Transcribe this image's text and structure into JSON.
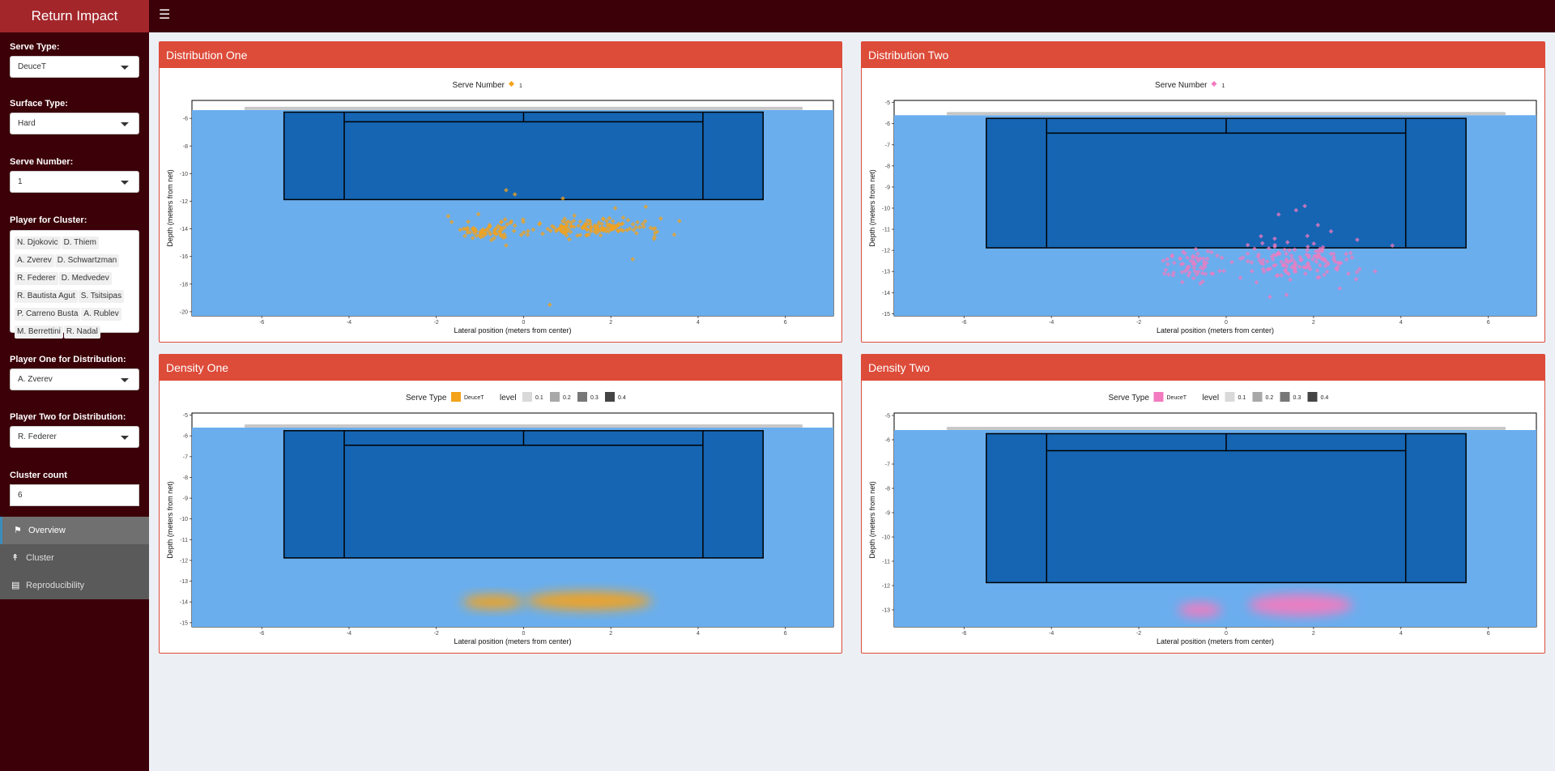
{
  "app": {
    "title": "Return Impact"
  },
  "sidebar": {
    "serve_type": {
      "label": "Serve Type:",
      "value": "DeuceT"
    },
    "surface_type": {
      "label": "Surface Type:",
      "value": "Hard"
    },
    "serve_number": {
      "label": "Serve Number:",
      "value": "1"
    },
    "player_cluster": {
      "label": "Player for Cluster:",
      "tags": [
        "N. Djokovic",
        "D. Thiem",
        "A. Zverev",
        "D. Schwartzman",
        "R. Federer",
        "D. Medvedev",
        "R. Bautista Agut",
        "S. Tsitsipas",
        "P. Carreno Busta",
        "A. Rublev",
        "M. Berrettini",
        "R. Nadal"
      ]
    },
    "player_one": {
      "label": "Player One for Distribution:",
      "value": "A. Zverev"
    },
    "player_two": {
      "label": "Player Two for Distribution:",
      "value": "R. Federer"
    },
    "cluster_count": {
      "label": "Cluster count",
      "value": "6"
    },
    "menu": [
      {
        "label": "Overview",
        "icon": "map-icon"
      },
      {
        "label": "Cluster",
        "icon": "line-chart-icon"
      },
      {
        "label": "Reproducibility",
        "icon": "book-icon"
      }
    ]
  },
  "boxes": {
    "dist_one": {
      "title": "Distribution One"
    },
    "dist_two": {
      "title": "Distribution Two"
    },
    "dens_one": {
      "title": "Density One"
    },
    "dens_two": {
      "title": "Density Two"
    }
  },
  "colors": {
    "accent": "#dd4b39",
    "sidebar": "#3b0008",
    "court_outer": "#6aaeee",
    "court_inner": "#1565b3",
    "orange": "#f4a21a",
    "pink": "#f27bc0"
  },
  "chart_data": [
    {
      "id": "dist_one",
      "type": "scatter",
      "xlabel": "Lateral position (meters from center)",
      "ylabel": "Depth (meters from net)",
      "xticks": [
        -6,
        -4,
        -2,
        0,
        2,
        4,
        6
      ],
      "yticks": [
        -6,
        -8,
        -10,
        -12,
        -14,
        -16,
        -18,
        -20
      ],
      "ylim": [
        -20.3,
        -4.7
      ],
      "legend": {
        "title": "Serve Number",
        "items": [
          "1"
        ],
        "position": "top"
      },
      "color": "#f4a21a",
      "clusters": [
        {
          "cx": -0.8,
          "cy": -14.1,
          "sx": 0.45,
          "sy": 0.35,
          "n": 70
        },
        {
          "cx": 1.6,
          "cy": -13.9,
          "sx": 0.8,
          "sy": 0.35,
          "n": 140
        }
      ],
      "outliers": [
        [
          -0.4,
          -11.2
        ],
        [
          -0.2,
          -11.5
        ],
        [
          0.9,
          -11.8
        ],
        [
          2.1,
          -12.5
        ],
        [
          2.5,
          -16.2
        ],
        [
          0.6,
          -19.5
        ],
        [
          -0.4,
          -15.2
        ],
        [
          2.8,
          -12.4
        ]
      ]
    },
    {
      "id": "dist_two",
      "type": "scatter",
      "xlabel": "Lateral position (meters from center)",
      "ylabel": "Depth (meters from net)",
      "xticks": [
        -6,
        -4,
        -2,
        0,
        2,
        4,
        6
      ],
      "yticks": [
        -5,
        -6,
        -7,
        -8,
        -9,
        -10,
        -11,
        -12,
        -13,
        -14,
        -15
      ],
      "ylim": [
        -15.1,
        -4.9
      ],
      "legend": {
        "title": "Serve Number",
        "items": [
          "1"
        ],
        "position": "top"
      },
      "color": "#f27bc0",
      "clusters": [
        {
          "cx": -0.8,
          "cy": -12.8,
          "sx": 0.35,
          "sy": 0.4,
          "n": 60
        },
        {
          "cx": 1.6,
          "cy": -12.5,
          "sx": 0.75,
          "sy": 0.45,
          "n": 140
        }
      ],
      "outliers": [
        [
          1.2,
          -10.3
        ],
        [
          1.6,
          -10.1
        ],
        [
          2.1,
          -10.8
        ],
        [
          2.4,
          -11.1
        ],
        [
          3.0,
          -11.5
        ],
        [
          1.0,
          -14.2
        ],
        [
          2.6,
          -13.8
        ],
        [
          1.8,
          -9.9
        ]
      ]
    },
    {
      "id": "dens_one",
      "type": "heatmap",
      "xlabel": "Lateral position (meters from center)",
      "ylabel": "Depth (meters from net)",
      "xticks": [
        -6,
        -4,
        -2,
        0,
        2,
        4,
        6
      ],
      "yticks": [
        -5,
        -6,
        -7,
        -8,
        -9,
        -10,
        -11,
        -12,
        -13,
        -14,
        -15
      ],
      "ylim": [
        -15.2,
        -4.9
      ],
      "legend": {
        "title": "Serve Type",
        "items": [
          "DeuceT"
        ],
        "level_title": "level",
        "levels": [
          "0.1",
          "0.2",
          "0.3",
          "0.4"
        ],
        "position": "top"
      },
      "color": "#f4a21a",
      "blobs": [
        {
          "cx": -0.7,
          "cy": -14.0,
          "rx": 0.7,
          "ry": 0.35
        },
        {
          "cx": 1.5,
          "cy": -13.95,
          "rx": 1.45,
          "ry": 0.45
        }
      ]
    },
    {
      "id": "dens_two",
      "type": "heatmap",
      "xlabel": "Lateral position (meters from center)",
      "ylabel": "Depth (meters from net)",
      "xticks": [
        -6,
        -4,
        -2,
        0,
        2,
        4,
        6
      ],
      "yticks": [
        -5,
        -6,
        -7,
        -8,
        -9,
        -10,
        -11,
        -12,
        -13
      ],
      "ylim": [
        -13.7,
        -4.9
      ],
      "legend": {
        "title": "Serve Type",
        "items": [
          "DeuceT"
        ],
        "level_title": "level",
        "levels": [
          "0.1",
          "0.2",
          "0.3",
          "0.4"
        ],
        "position": "top"
      },
      "color": "#f27bc0",
      "blobs": [
        {
          "cx": -0.6,
          "cy": -13.0,
          "rx": 0.5,
          "ry": 0.3
        },
        {
          "cx": 1.7,
          "cy": -12.8,
          "rx": 1.2,
          "ry": 0.45
        }
      ]
    }
  ]
}
